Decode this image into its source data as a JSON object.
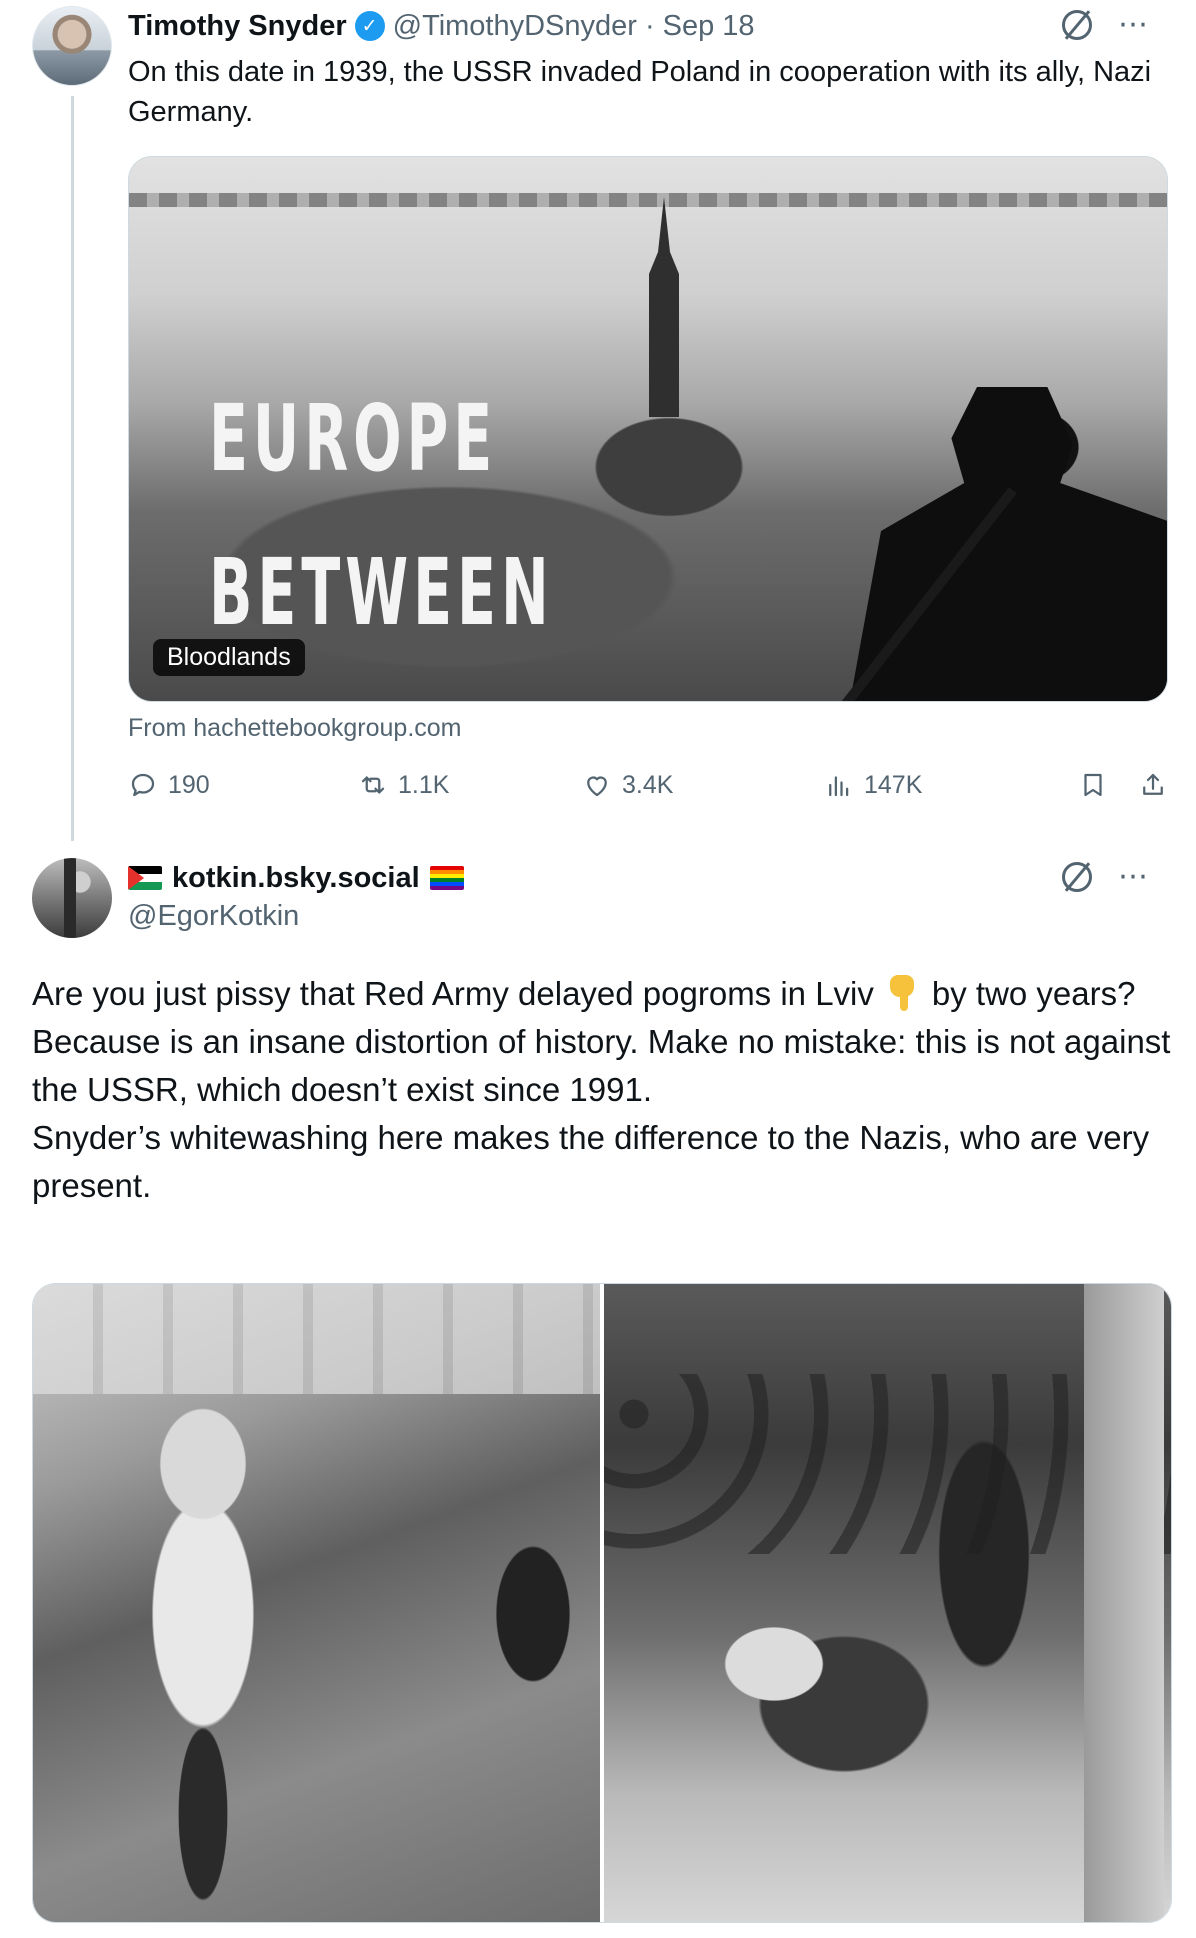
{
  "tweet1": {
    "author_name": "Timothy Snyder",
    "verified_mark": "✓",
    "handle": "@TimothyDSnyder",
    "separator": "·",
    "date": "Sep 18",
    "text": "On this date in 1939, the USSR invaded Poland in cooperation with its ally, Nazi Germany.",
    "card": {
      "title_line1": "EUROPE",
      "title_line2": "BETWEEN",
      "label": "Bloodlands",
      "source": "From hachettebookgroup.com"
    },
    "stats": {
      "replies": "190",
      "reposts": "1.1K",
      "likes": "3.4K",
      "views": "147K"
    },
    "icons": [
      "grok-icon",
      "more-icon",
      "reply-icon",
      "repost-icon",
      "like-icon",
      "views-icon",
      "bookmark-icon",
      "share-icon"
    ]
  },
  "tweet2": {
    "author_name": "kotkin.bsky.social",
    "handle": "@EgorKotkin",
    "line1_before_emoji": "Are you just pissy that Red Army delayed pogroms in Lviv",
    "line1_after_emoji": "by two years?",
    "line2": "Because is an insane distortion of history. Make no mistake: this is not against the USSR, which doesn’t exist since 1991.",
    "line3": "Snyder’s whitewashing here makes the difference to the Nazis, who are very present.",
    "emoji": "pointing-down-emoji",
    "flags": [
      "palestine-flag",
      "rainbow-flag"
    ]
  },
  "colors": {
    "text_primary": "#0f1419",
    "text_secondary": "#536471",
    "verified_blue": "#1d9bf0",
    "border": "#cfd9de"
  }
}
